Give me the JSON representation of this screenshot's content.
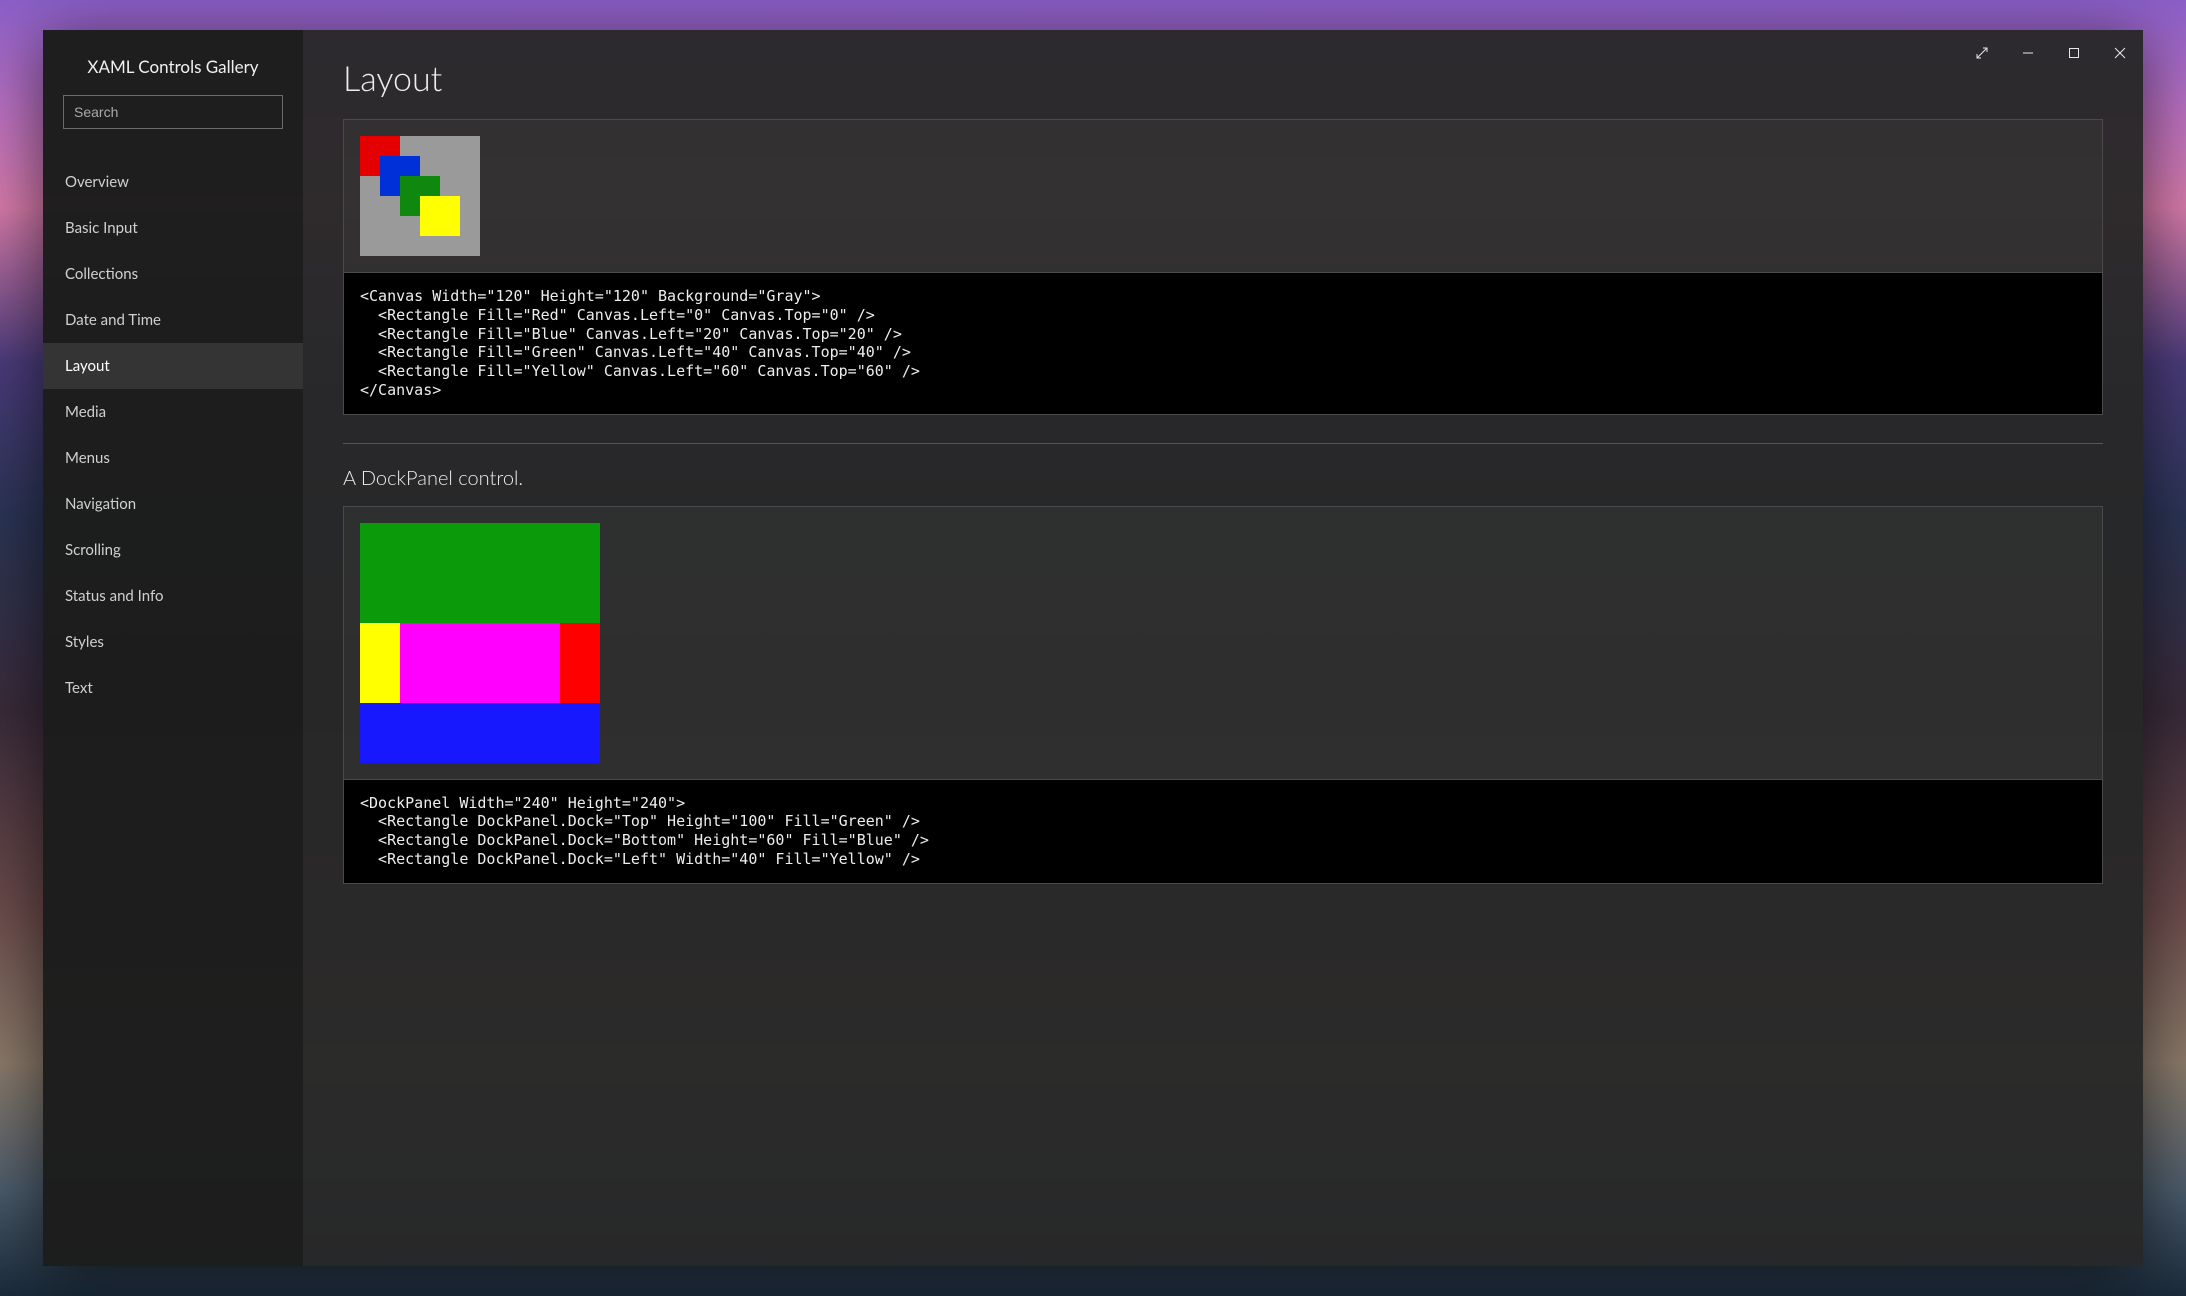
{
  "app": {
    "title": "XAML Controls Gallery"
  },
  "search": {
    "placeholder": "Search",
    "value": ""
  },
  "nav": {
    "items": [
      {
        "label": "Overview",
        "active": false
      },
      {
        "label": "Basic Input",
        "active": false
      },
      {
        "label": "Collections",
        "active": false
      },
      {
        "label": "Date and Time",
        "active": false
      },
      {
        "label": "Layout",
        "active": true
      },
      {
        "label": "Media",
        "active": false
      },
      {
        "label": "Menus",
        "active": false
      },
      {
        "label": "Navigation",
        "active": false
      },
      {
        "label": "Scrolling",
        "active": false
      },
      {
        "label": "Status and Info",
        "active": false
      },
      {
        "label": "Styles",
        "active": false
      },
      {
        "label": "Text",
        "active": false
      }
    ]
  },
  "page": {
    "title": "Layout"
  },
  "examples": {
    "canvas": {
      "code": "<Canvas Width=\"120\" Height=\"120\" Background=\"Gray\">\n  <Rectangle Fill=\"Red\" Canvas.Left=\"0\" Canvas.Top=\"0\" />\n  <Rectangle Fill=\"Blue\" Canvas.Left=\"20\" Canvas.Top=\"20\" />\n  <Rectangle Fill=\"Green\" Canvas.Left=\"40\" Canvas.Top=\"40\" />\n  <Rectangle Fill=\"Yellow\" Canvas.Left=\"60\" Canvas.Top=\"60\" />\n</Canvas>"
    },
    "dockpanel": {
      "heading": "A DockPanel control.",
      "code": "<DockPanel Width=\"240\" Height=\"240\">\n  <Rectangle DockPanel.Dock=\"Top\" Height=\"100\" Fill=\"Green\" />\n  <Rectangle DockPanel.Dock=\"Bottom\" Height=\"60\" Fill=\"Blue\" />\n  <Rectangle DockPanel.Dock=\"Left\" Width=\"40\" Fill=\"Yellow\" />"
    }
  }
}
